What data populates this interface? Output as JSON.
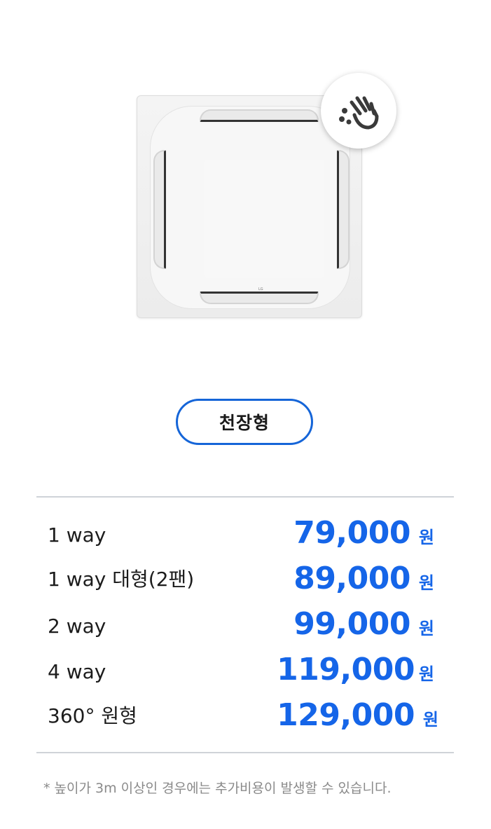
{
  "product": {
    "gesture_icon": "hand-wave-icon",
    "brand_mark": "LG"
  },
  "type_badge": "천장형",
  "prices": [
    {
      "label": "1 way",
      "value": "79,000",
      "unit": "원"
    },
    {
      "label": "1 way 대형(2팬)",
      "value": "89,000",
      "unit": "원"
    },
    {
      "label": "2 way",
      "value": "99,000",
      "unit": "원"
    },
    {
      "label": "4 way",
      "value": "119,000",
      "unit": "원"
    },
    {
      "label": "360°  원형",
      "value": "129,000",
      "unit": "원"
    }
  ],
  "footnote": "* 높이가 3m 이상인 경우에는 추가비용이 발생할 수  있습니다.",
  "colors": {
    "accent": "#1565e8",
    "badge_border": "#1565d8",
    "divider": "#cfd3d8",
    "footnote": "#8a8a8a"
  }
}
